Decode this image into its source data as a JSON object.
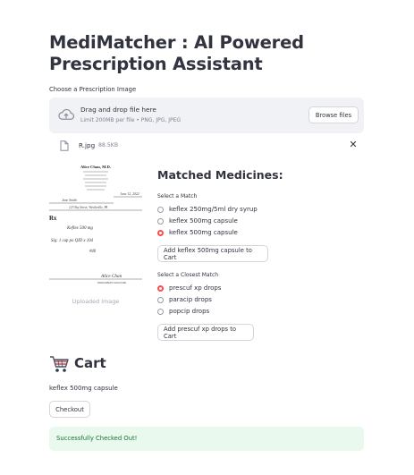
{
  "app": {
    "title": "MediMatcher : AI Powered Prescription Assistant"
  },
  "uploader": {
    "label": "Choose a Prescription Image",
    "drop_text": "Drag and drop file here",
    "limits": "Limit 200MB per file • PNG, JPG, JPEG",
    "browse_label": "Browse files",
    "file_name": "R.jpg",
    "file_size": "88.5KB",
    "close_glyph": "✕"
  },
  "prescription_image": {
    "caption": "Uploaded Image",
    "doctor_name": "Alice Chan, M.D.",
    "patient_name": "Jane Smith",
    "address": "123 Sky Street, Westleville, PA",
    "date": "June 12, 2022",
    "drug_line": "Keflex 500 mg",
    "sig_line": "Sig: 1 cap po QID x 10d",
    "qty_line": "#40",
    "signature": "Alice Chan",
    "prescriber_label": "PRESCRIBER'S SIGNATURE"
  },
  "matched": {
    "heading": "Matched Medicines:",
    "select_label": "Select a Match",
    "options": [
      "keflex 250mg/5ml dry syrup",
      "keflex 500mg capsule",
      "keflex 500mg capsule"
    ],
    "selected_index": 2,
    "add_button": "Add keflex 500mg capsule to Cart",
    "closest_label": "Select a Closest Match",
    "closest_options": [
      "prescuf xp drops",
      "paracip drops",
      "popcip drops"
    ],
    "closest_selected_index": 0,
    "add_closest_button": "Add prescuf xp drops to Cart"
  },
  "cart": {
    "icon": "cart-icon",
    "title": "Cart",
    "items": [
      "keflex 500mg capsule"
    ],
    "checkout_label": "Checkout",
    "success_message": "Successfully Checked Out!"
  },
  "colors": {
    "accent": "#ff4b4b",
    "success_bg": "#e9f9ee",
    "success_text": "#177233",
    "dropzone_bg": "#f0f2f6"
  }
}
